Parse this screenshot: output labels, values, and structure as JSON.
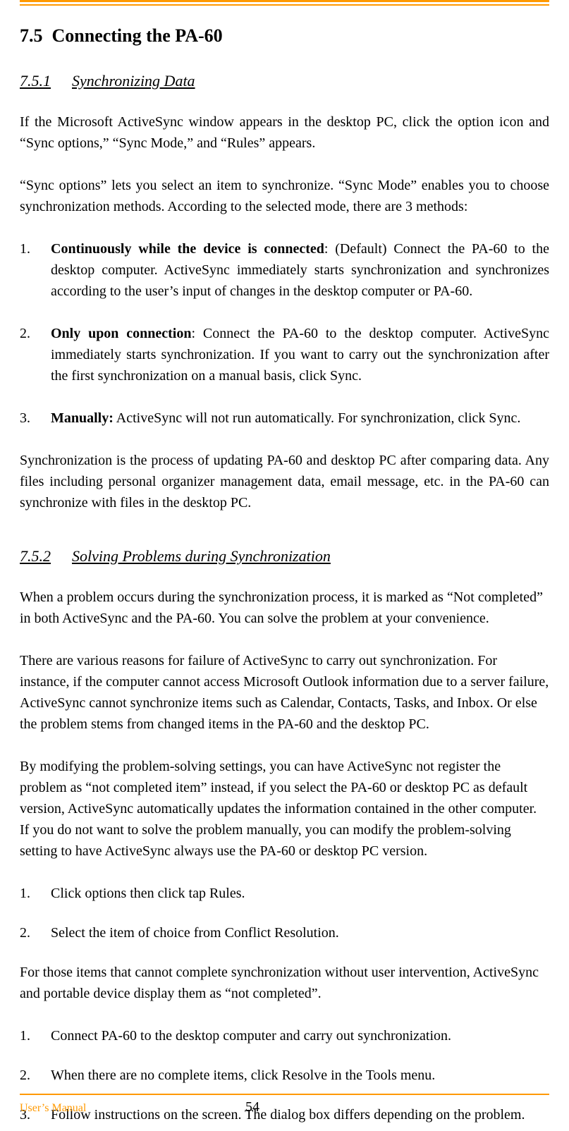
{
  "header": {
    "section_num": "7.5",
    "section_title": "Connecting the PA-60"
  },
  "sub1": {
    "num": "7.5.1",
    "title": "Synchronizing Data",
    "p1": "If the Microsoft ActiveSync window appears in the desktop PC, click the option icon and “Sync options,” “Sync Mode,” and “Rules” appears.",
    "p2": "“Sync options” lets you select an item to synchronize. “Sync Mode” enables you to choose synchronization methods. According to the selected mode, there are 3 methods:",
    "items": [
      {
        "num": "1.",
        "bold": "Continuously while the device is connected",
        "rest": ": (Default) Connect the PA-60 to the desktop computer. ActiveSync immediately starts synchronization and synchronizes according to the user’s input of changes in the desktop computer or PA-60."
      },
      {
        "num": "2.",
        "bold": "Only upon connection",
        "rest": ": Connect the PA-60 to the desktop computer. ActiveSync immediately starts synchronization. If you want to carry out the synchronization after the first synchronization on a manual basis, click Sync."
      },
      {
        "num": "3.",
        "bold": "Manually:",
        "rest": " ActiveSync will not run automatically. For synchronization, click Sync."
      }
    ],
    "p3": "Synchronization is the process of updating PA-60 and desktop PC after comparing data. Any files including personal organizer management data, email message, etc. in the PA-60 can synchronize with files in the desktop PC."
  },
  "sub2": {
    "num": "7.5.2",
    "title": "Solving Problems during Synchronization",
    "p1": "When a problem occurs during the synchronization process, it is marked as “Not completed” in both ActiveSync and the PA-60. You can solve the problem at your convenience.",
    "p2": "There are various reasons for failure of ActiveSync to carry out synchronization. For instance, if the computer cannot access Microsoft Outlook information due to a server failure, ActiveSync cannot synchronize items such as Calendar, Contacts, Tasks, and Inbox. Or else the problem stems from changed items in the PA-60 and the desktop PC.",
    "p3": "By modifying the problem-solving settings, you can have ActiveSync not register the problem as “not completed item” instead, if you select the PA-60 or desktop PC as default version, ActiveSync automatically updates the information contained in the other computer. If you do not want to solve the problem manually, you can modify the problem-solving setting to have ActiveSync always use the PA-60 or desktop PC version.",
    "listA": [
      {
        "num": "1.",
        "text": "Click options then click tap Rules."
      },
      {
        "num": "2.",
        "text": "Select the item of choice from Conflict Resolution."
      }
    ],
    "p4": "For those items that cannot complete synchronization without user intervention, ActiveSync and portable device display them as “not completed”.",
    "listB": [
      {
        "num": "1.",
        "text": "Connect PA-60 to the desktop computer and carry out synchronization."
      },
      {
        "num": "2.",
        "text": "When there are no complete items, click Resolve in the Tools menu."
      },
      {
        "num": "3.",
        "text": "Follow instructions on the screen. The dialog box differs depending on the problem."
      }
    ]
  },
  "footer": {
    "left": "User’s Manual",
    "page": "54"
  }
}
